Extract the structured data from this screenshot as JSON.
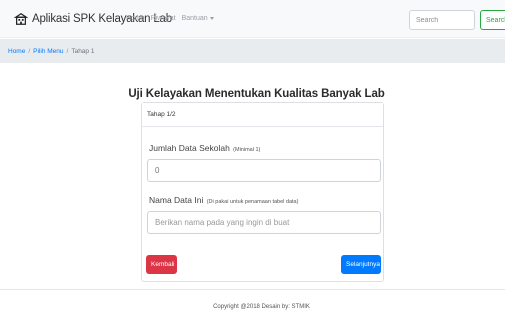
{
  "navbar": {
    "brand": "Aplikasi SPK Kelayakan Lab",
    "links": [
      "Home",
      "Riwayat",
      "Bantuan"
    ],
    "search_placeholder": "Search",
    "search_button": "Search"
  },
  "breadcrumb": {
    "items": [
      "Home",
      "Pilih Menu"
    ],
    "active": "Tahap 1"
  },
  "main": {
    "title": "Uji Kelayakan Menentukan Kualitas Banyak Lab",
    "card": {
      "header": "Tahap 1/2",
      "field1": {
        "label": "Jumlah Data Sekolah",
        "hint": "(Minimal 1)",
        "value": "0"
      },
      "field2": {
        "label": "Nama Data Ini",
        "hint": "(Di pakai untuk penamaan tabel data)",
        "placeholder": "Berikan nama pada yang ingin di buat"
      },
      "back_button": "Kembali",
      "next_button": "Selanjutnya"
    }
  },
  "footer": {
    "text": "Copyright @2018 Desain by: STMIK"
  },
  "colors": {
    "danger": "#dc3545",
    "primary": "#007bff",
    "success": "#28a745"
  }
}
